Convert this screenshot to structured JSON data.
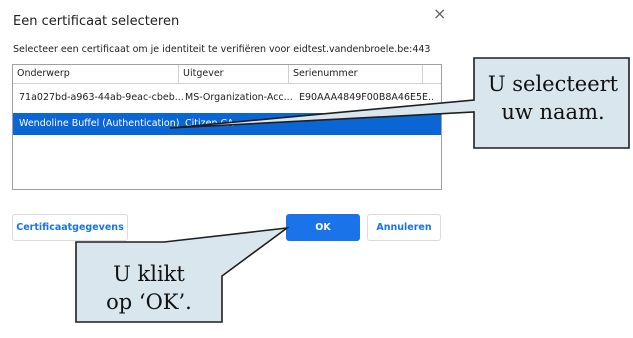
{
  "dialog": {
    "title": "Een certificaat selecteren",
    "close_glyph": "×",
    "subtitle": "Selecteer een certificaat om je identiteit te verifiëren voor eidtest.vandenbroele.be:443"
  },
  "table": {
    "columns": [
      "Onderwerp",
      "Uitgever",
      "Serienummer"
    ],
    "rows": [
      {
        "subject": "71a027bd-a963-44ab-9eac-cbeb...",
        "issuer": "MS-Organization-Acc...",
        "serial": "E90AAA4849F00B8A46E5E...",
        "selected": false
      },
      {
        "subject": "Wendoline Buffel (Authentication)",
        "issuer": "Citizen CA",
        "serial": "",
        "selected": true
      }
    ]
  },
  "buttons": {
    "details": "Certificaatgegevens",
    "ok": "OK",
    "cancel": "Annuleren"
  },
  "callouts": {
    "select_line1": "U selecteert",
    "select_line2": "uw naam.",
    "ok_line1": "U klikt",
    "ok_line2": "op ‘OK’."
  },
  "colors": {
    "accent": "#1a73e8",
    "selected_row": "#0a66d4",
    "callout_fill": "#d9e6ee"
  }
}
